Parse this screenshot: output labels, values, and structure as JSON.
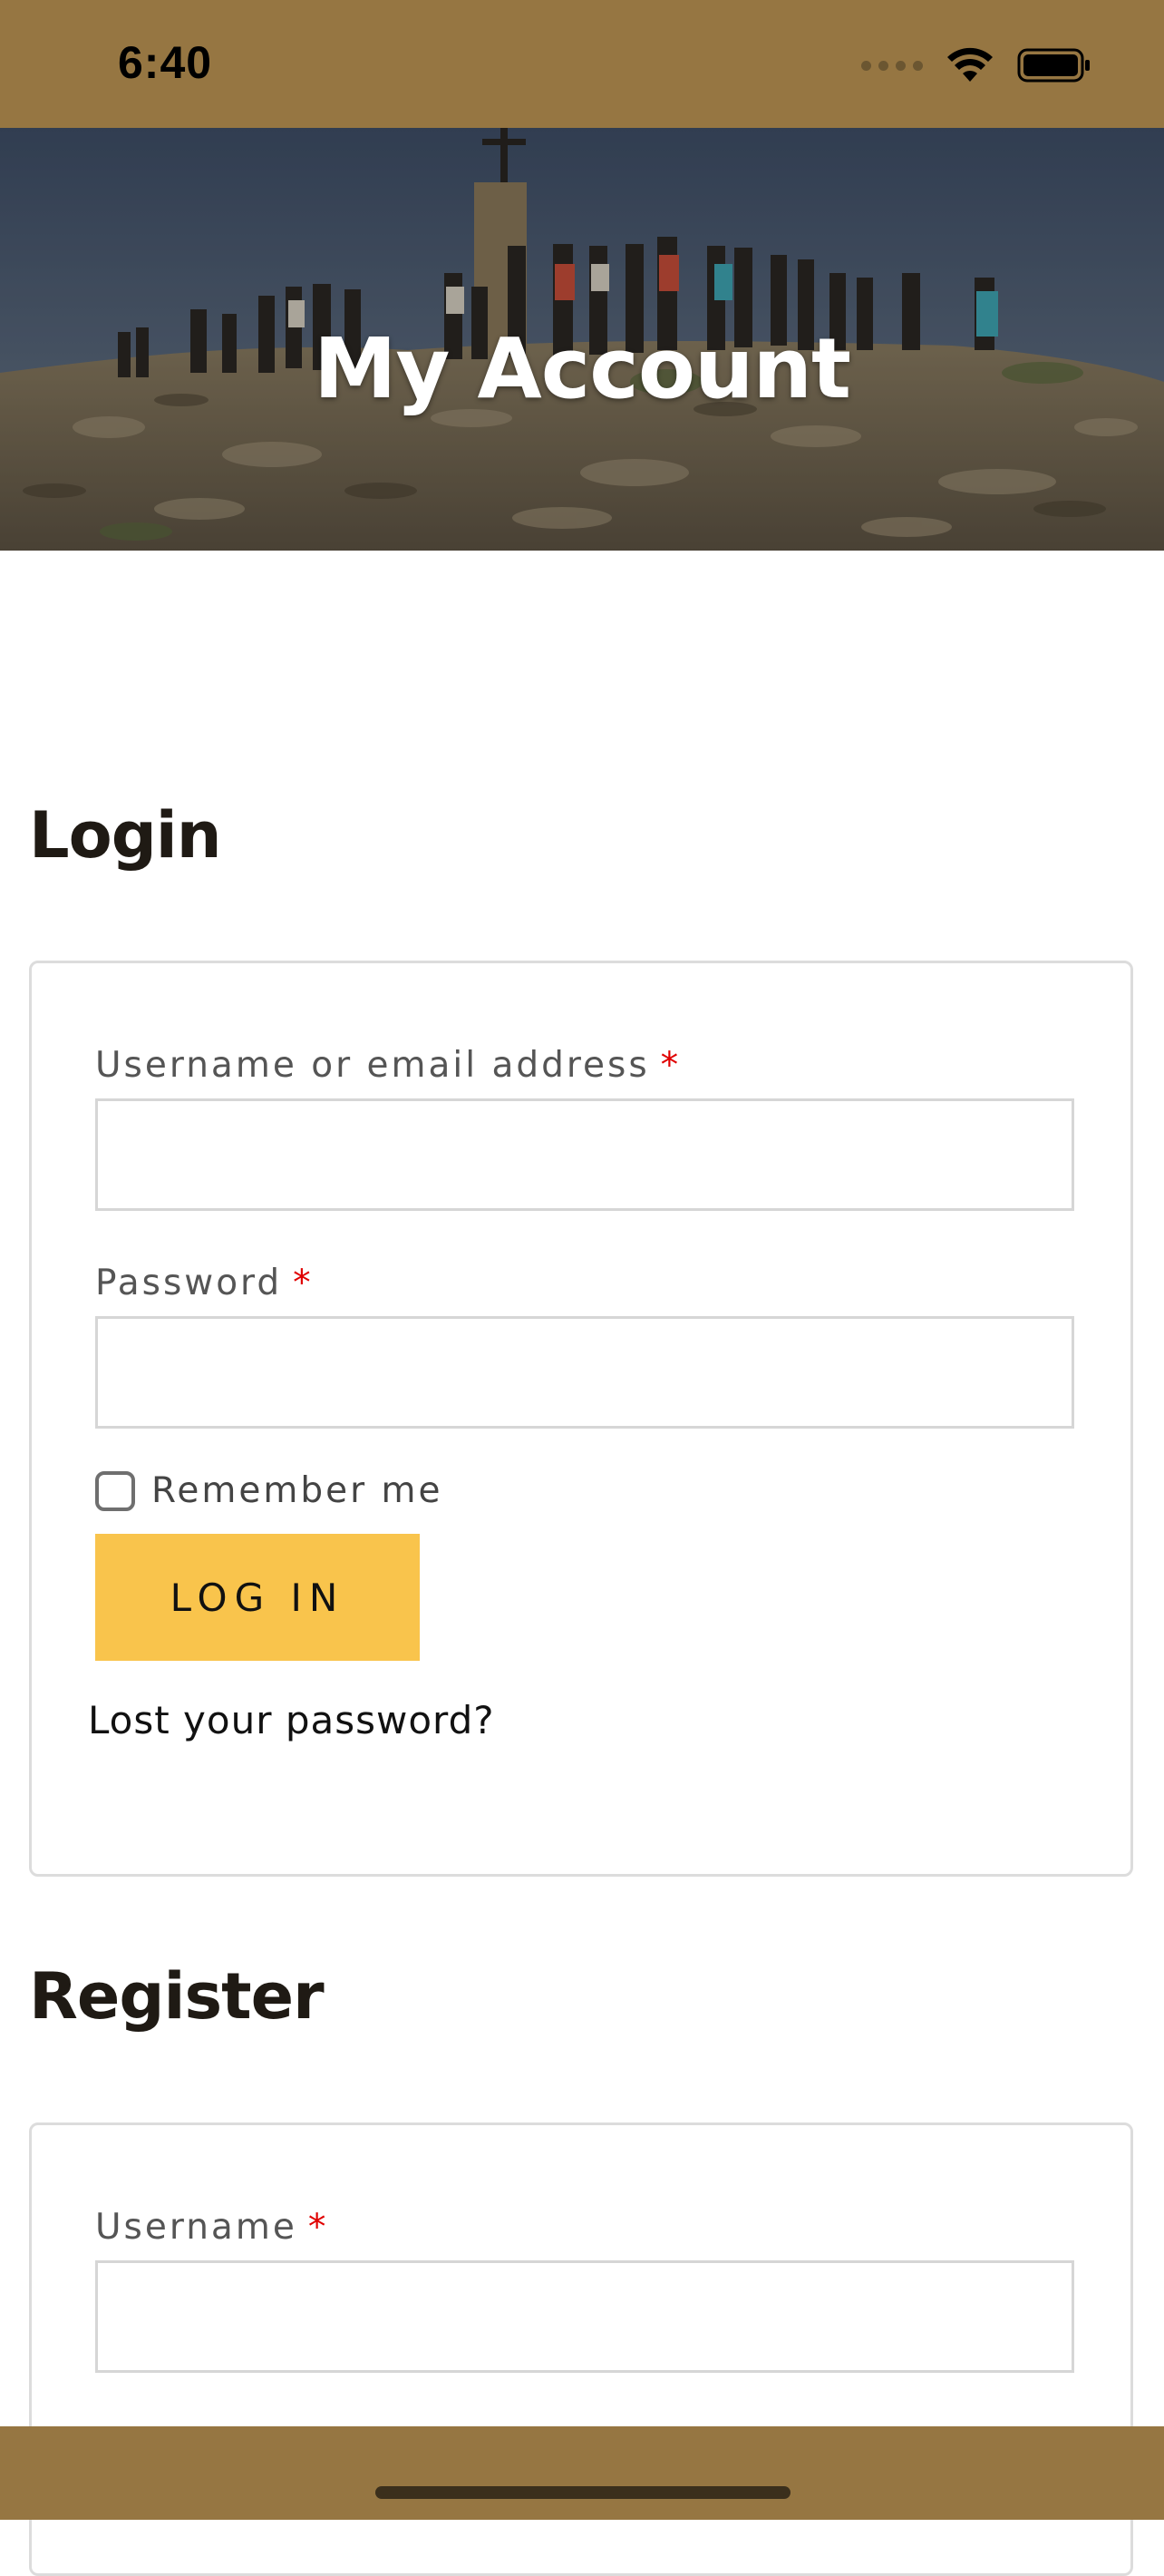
{
  "status_bar": {
    "time": "6:40"
  },
  "hero": {
    "title": "My Account"
  },
  "login": {
    "heading": "Login",
    "username_label": "Username or email address",
    "username_value": "",
    "password_label": "Password",
    "password_value": "",
    "required_mark": "*",
    "remember_label": "Remember me",
    "remember_checked": false,
    "button_label": "LOG IN",
    "lost_password": "Lost your password?"
  },
  "register": {
    "heading": "Register",
    "username_label": "Username",
    "username_value": "",
    "required_mark": "*"
  },
  "colors": {
    "status_bar": "#967642",
    "button": "#f9c44c",
    "required": "#e00000"
  }
}
